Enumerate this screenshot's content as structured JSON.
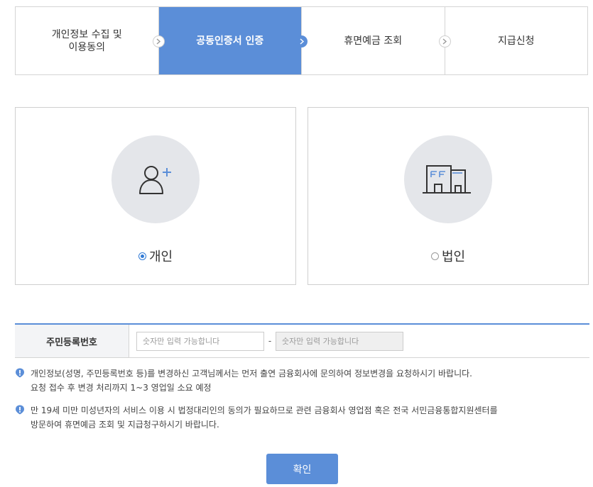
{
  "steps": [
    {
      "label": "개인정보 수집 및\n이용동의",
      "active": false
    },
    {
      "label": "공동인증서 인증",
      "active": true
    },
    {
      "label": "휴면예금 조회",
      "active": false
    },
    {
      "label": "지급신청",
      "active": false
    }
  ],
  "customer_type": {
    "personal": {
      "label": "개인",
      "icon": "person-add-icon",
      "selected": true
    },
    "corporate": {
      "label": "법인",
      "icon": "building-icon",
      "selected": false
    }
  },
  "rrn": {
    "label": "주민등록번호",
    "first_placeholder": "숫자만 입력 가능합니다",
    "separator": "-",
    "second_placeholder": "숫자만 입력 가능합니다"
  },
  "notices": [
    "개인정보(성명, 주민등록번호 등)를 변경하신 고객님께서는 먼저 출연 금융회사에 문의하여 정보변경을 요청하시기 바랍니다.\n요청 접수 후 변경 처리까지 1~3 영업일 소요 예정",
    "만 19세 미만 미성년자의 서비스 이용 시 법정대리인의 동의가 필요하므로 관련 금융회사 영업점 혹은 전국 서민금융통합지원센터를\n방문하여 휴면예금 조회 및 지급청구하시기 바랍니다."
  ],
  "confirm_label": "확인",
  "colors": {
    "accent": "#5b8ed8",
    "card_circle": "#e4e6ea",
    "notice_icon": "#5b8ed8"
  }
}
